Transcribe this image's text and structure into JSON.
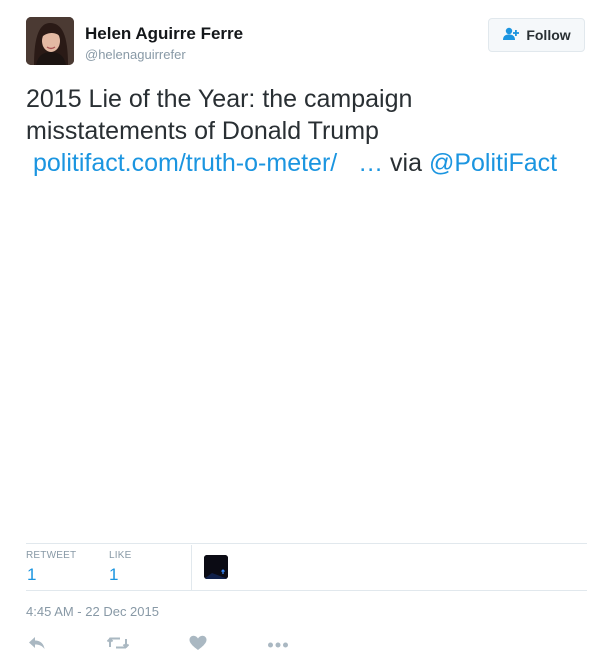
{
  "user": {
    "name": "Helen Aguirre Ferre",
    "handle": "@helenaguirrefer"
  },
  "follow_button": {
    "label": "Follow",
    "icon": "add-user-icon"
  },
  "tweet": {
    "line1": "2015 Lie of the Year: the campaign",
    "line2": "misstatements of Donald Trump",
    "link": "politifact.com/truth-o-meter/",
    "ellipsis": "…",
    "via": "via",
    "mention": "@PolitiFact"
  },
  "stats": {
    "retweet_label": "RETWEET",
    "retweet_count": "1",
    "like_label": "LIKE",
    "like_count": "1"
  },
  "timestamp": "4:45 AM - 22 Dec 2015",
  "actions": [
    "reply-icon",
    "retweet-icon",
    "like-icon",
    "more-icon"
  ],
  "colors": {
    "link": "#1b95e0",
    "text": "#292f33",
    "muted": "#8899a6",
    "divider": "#e1e8ed",
    "icon": "#aab8c2"
  }
}
